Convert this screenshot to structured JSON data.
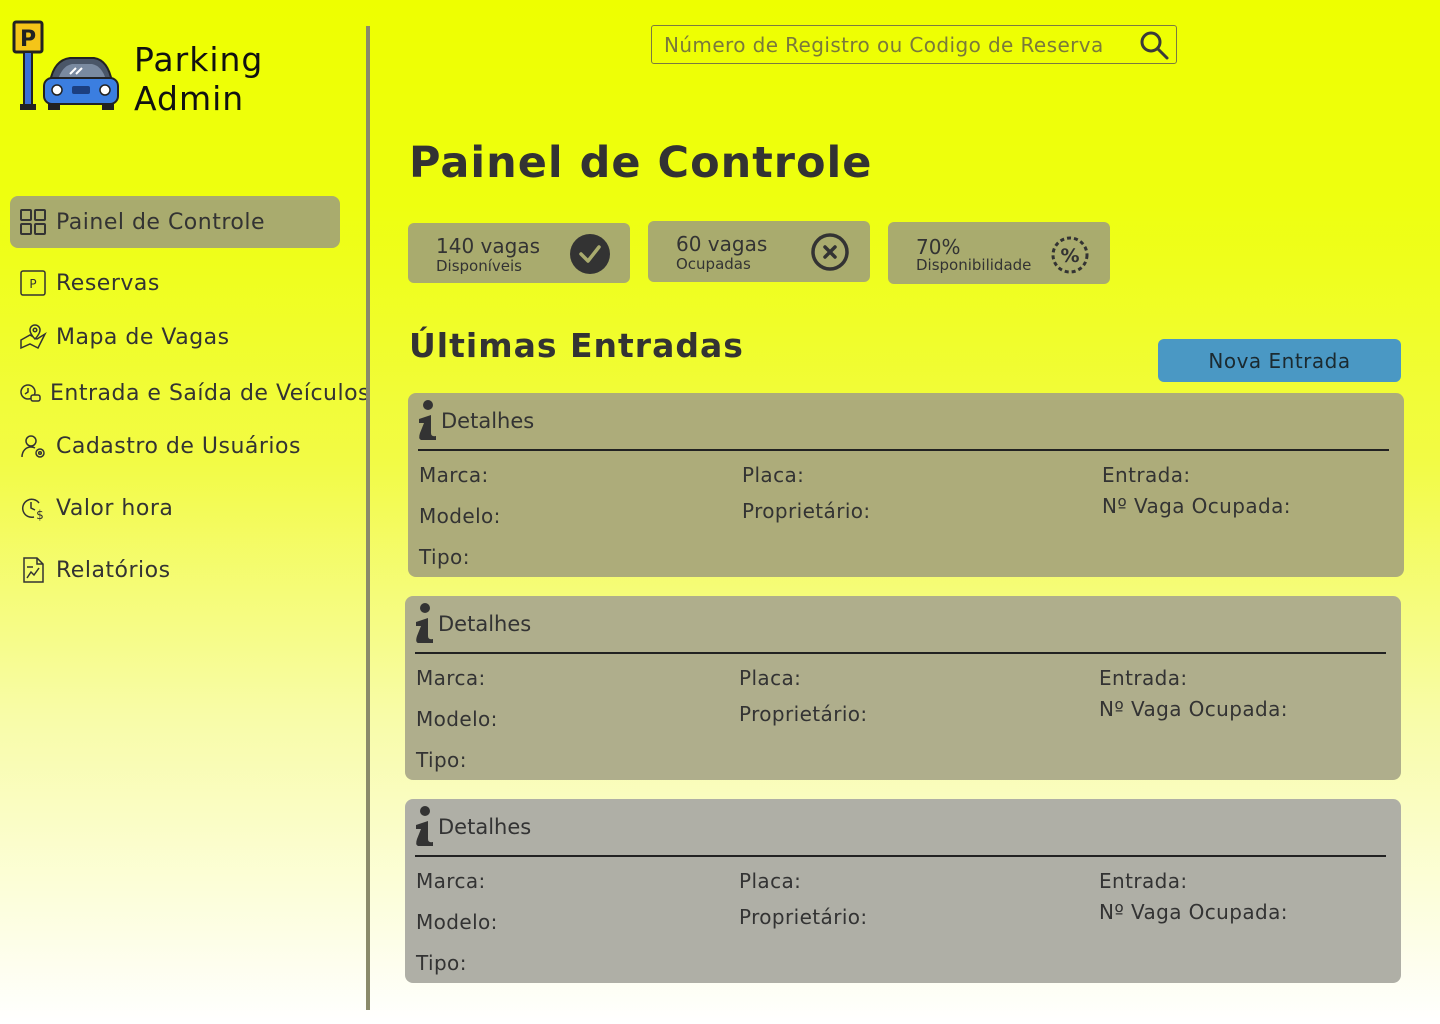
{
  "app": {
    "brand_line1": "Parking",
    "brand_line2": "Admin"
  },
  "sidebar": {
    "items": [
      {
        "label": "Painel de Controle",
        "icon": "grid-icon",
        "active": true
      },
      {
        "label": "Reservas",
        "icon": "parking-p-icon"
      },
      {
        "label": "Mapa de Vagas",
        "icon": "map-pin-icon"
      },
      {
        "label": "Entrada e Saída de Veículos",
        "icon": "clock-car-icon"
      },
      {
        "label": "Cadastro de Usuários",
        "icon": "user-gear-icon"
      },
      {
        "label": "Valor hora",
        "icon": "clock-dollar-icon"
      },
      {
        "label": "Relatórios",
        "icon": "report-chart-icon"
      }
    ]
  },
  "search": {
    "placeholder": "Número de Registro ou Codigo de Reserva",
    "value": ""
  },
  "main": {
    "title": "Painel de Controle",
    "stats": [
      {
        "value": "140 vagas",
        "label": "Disponíveis",
        "icon": "check-circle-icon"
      },
      {
        "value": "60 vagas",
        "label": "Ocupadas",
        "icon": "x-circle-icon"
      },
      {
        "value": "70%",
        "label": "Disponibilidade",
        "icon": "percent-circle-icon"
      }
    ],
    "entries_title": "Últimas Entradas",
    "new_entry_label": "Nova Entrada",
    "entries": [
      {
        "header": "Detalhes",
        "marca": "Marca:",
        "modelo": "Modelo:",
        "tipo": "Tipo:",
        "placa": "Placa:",
        "proprietario": "Proprietário:",
        "entrada": "Entrada:",
        "vaga": "Nº Vaga Ocupada:"
      },
      {
        "header": "Detalhes",
        "marca": "Marca:",
        "modelo": "Modelo:",
        "tipo": "Tipo:",
        "placa": "Placa:",
        "proprietario": "Proprietário:",
        "entrada": "Entrada:",
        "vaga": "Nº Vaga Ocupada:"
      },
      {
        "header": "Detalhes",
        "marca": "Marca:",
        "modelo": "Modelo:",
        "tipo": "Tipo:",
        "placa": "Placa:",
        "proprietario": "Proprietário:",
        "entrada": "Entrada:",
        "vaga": "Nº Vaga Ocupada:"
      }
    ]
  },
  "colors": {
    "accent_button": "#4a98c4",
    "panel_olive": "#a9ab6e",
    "background_top": "#eeff00",
    "background_bottom": "#ffffff"
  }
}
